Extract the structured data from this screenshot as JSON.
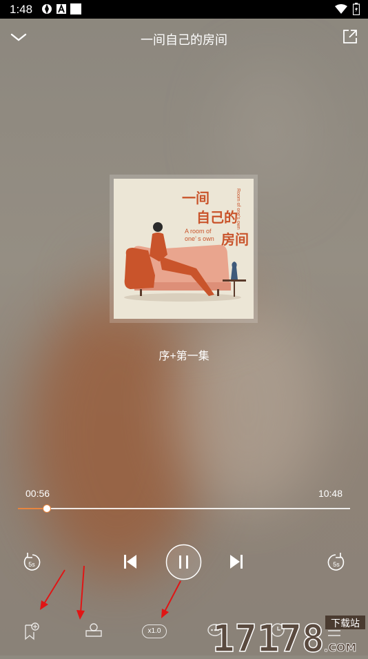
{
  "status_bar": {
    "time": "1:48"
  },
  "header": {
    "title": "一间自己的房间"
  },
  "cover": {
    "title_line1": "一间",
    "title_line2": "自己的",
    "title_line3": "房间",
    "english_line1": "A room of",
    "english_line2": "one’ s own",
    "vertical_text": "Room of one's own"
  },
  "episode": {
    "title": "序+第一集"
  },
  "progress": {
    "current": "00:56",
    "total": "10:48",
    "fraction": 0.087
  },
  "controls": {
    "skip_seconds": "5s"
  },
  "bottom_bar": {
    "speed_label": "x1.0"
  },
  "watermark": {
    "number": "17178",
    "suffix": ".COM",
    "tag": "下载站"
  },
  "colors": {
    "accent": "#e7853f",
    "cover_text": "#c9542b",
    "annotation_arrow": "#e01515"
  }
}
